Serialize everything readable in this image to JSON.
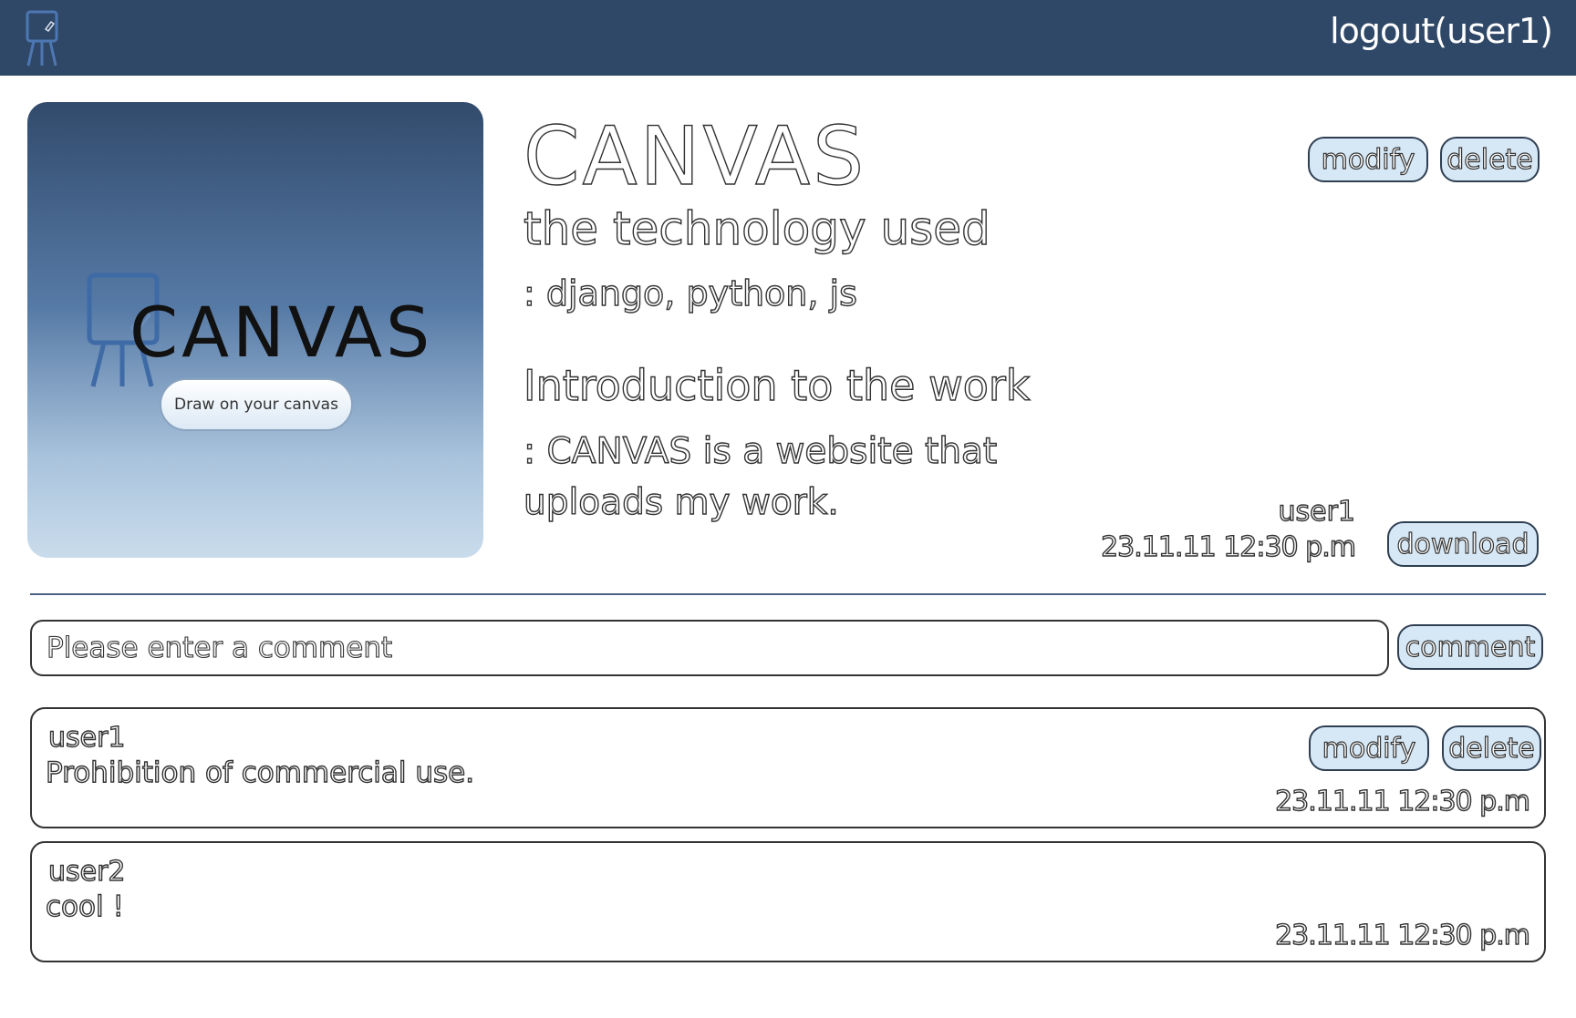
{
  "header": {
    "logo_icon": "easel-icon",
    "logout_label": "logout(user1)"
  },
  "hero": {
    "title": "CANVAS",
    "cta_label": "Draw on your canvas",
    "icon": "easel-icon"
  },
  "post": {
    "title": "CANVAS",
    "tech_heading": "the technology used",
    "tech_value": ": django, python, js",
    "intro_heading": "Introduction to the work",
    "intro_value": ": CANVAS is a website that uploads my work.",
    "author": "user1",
    "date": "23.11.11 12:30 p.m",
    "modify_label": "modify",
    "delete_label": "delete",
    "download_label": "download"
  },
  "comment_form": {
    "placeholder": "Please enter a comment",
    "submit_label": "comment"
  },
  "comments": [
    {
      "user": "user1",
      "text": "Prohibition of commercial use.",
      "date": "23.11.11 12:30 p.m",
      "modify_label": "modify",
      "delete_label": "delete"
    },
    {
      "user": "user2",
      "text": "cool !",
      "date": "23.11.11 12:30 p.m"
    }
  ],
  "colors": {
    "header_bg": "#304867",
    "button_bg": "#d6e8f6",
    "divider": "#4b6283"
  }
}
